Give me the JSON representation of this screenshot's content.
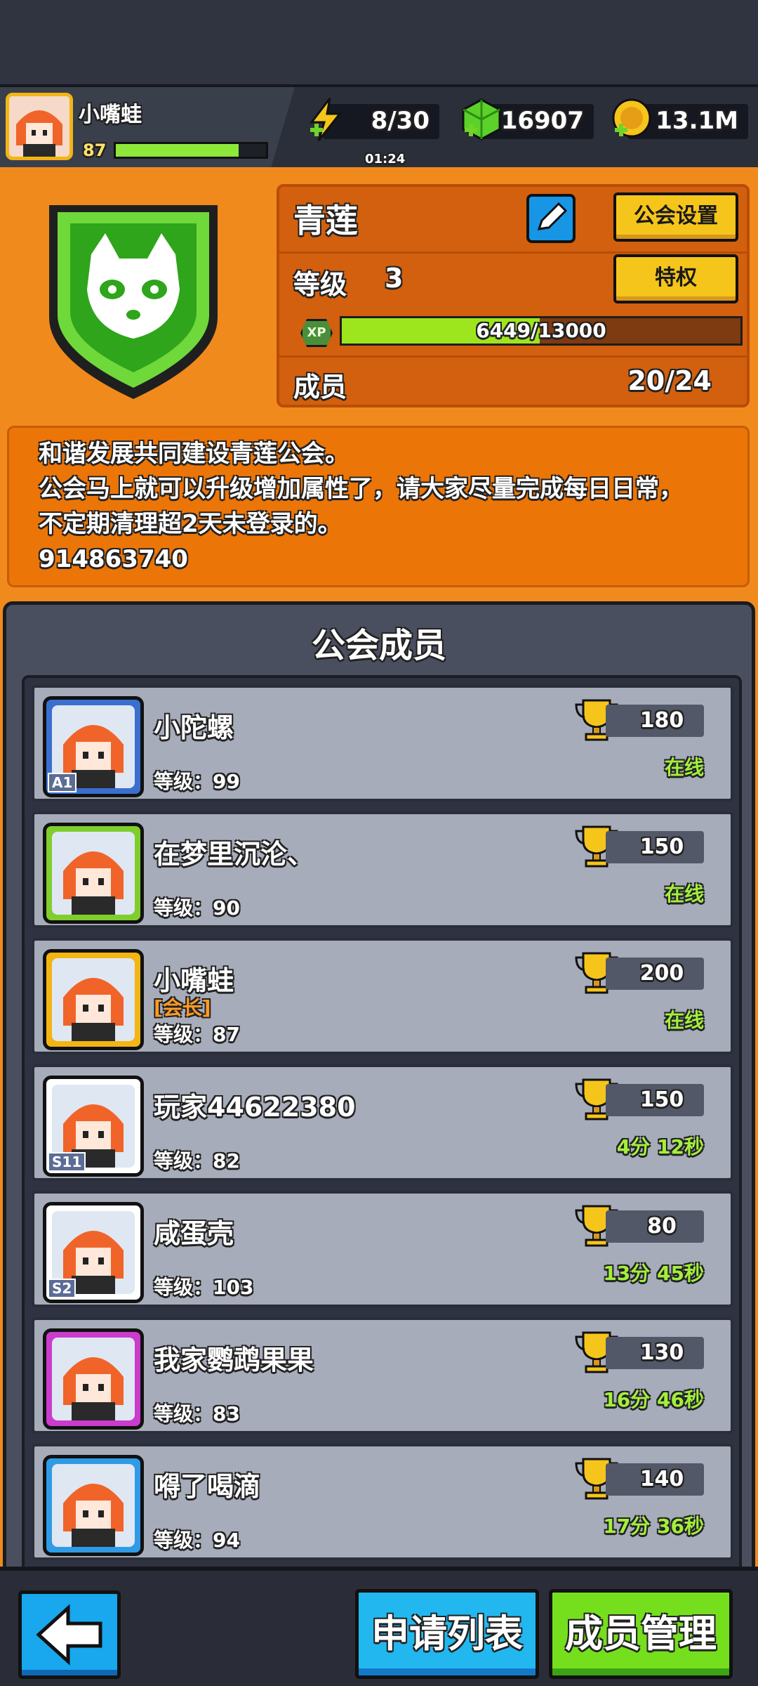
{
  "player": {
    "name": "小嘴蛙",
    "level": "87",
    "xp_fraction": 0.82
  },
  "resources": {
    "energy": "8/30",
    "energy_timer": "01:24",
    "gems": "16907",
    "coins": "13.1M"
  },
  "guild": {
    "name": "青莲",
    "settings_label": "公会设置",
    "privilege_label": "特权",
    "level_label": "等级",
    "level": "3",
    "xp_icon": "XP",
    "xp_text": "6449/13000",
    "xp_fraction": 0.496,
    "members_label": "成员",
    "members_count": "20/24"
  },
  "announcement": [
    "和谐发展共同建设青莲公会。",
    "公会马上就可以升级增加属性了，请大家尽量完成每日日常，",
    "不定期清理超2天未登录的。",
    "914863740"
  ],
  "members_panel": {
    "title": "公会成员",
    "members": [
      {
        "name": "小陀螺",
        "role": "",
        "level": "等级：99",
        "trophies": "180",
        "status": "在线",
        "tag": "A1",
        "avatar_color": "#3a6fd0"
      },
      {
        "name": "在梦里沉沦、",
        "role": "",
        "level": "等级：90",
        "trophies": "150",
        "status": "在线",
        "tag": "",
        "avatar_color": "#7fce2e"
      },
      {
        "name": "小嘴蛙",
        "role": "[会长]",
        "level": "等级：87",
        "trophies": "200",
        "status": "在线",
        "tag": "",
        "avatar_color": "#f2b514"
      },
      {
        "name": "玩家44622380",
        "role": "",
        "level": "等级：82",
        "trophies": "150",
        "status": "4分 12秒",
        "tag": "S11",
        "avatar_color": "#ffffff"
      },
      {
        "name": "咸蛋壳",
        "role": "",
        "level": "等级：103",
        "trophies": "80",
        "status": "13分 45秒",
        "tag": "S2",
        "avatar_color": "#ffffff"
      },
      {
        "name": "我家鹦鹉果果",
        "role": "",
        "level": "等级：83",
        "trophies": "130",
        "status": "16分 46秒",
        "tag": "",
        "avatar_color": "#c93ccc"
      },
      {
        "name": "嘚了喝滴",
        "role": "",
        "level": "等级：94",
        "trophies": "140",
        "status": "17分 36秒",
        "tag": "",
        "avatar_color": "#2f9be6"
      }
    ]
  },
  "bottom": {
    "apply_list": "申请列表",
    "manage_members": "成员管理"
  }
}
